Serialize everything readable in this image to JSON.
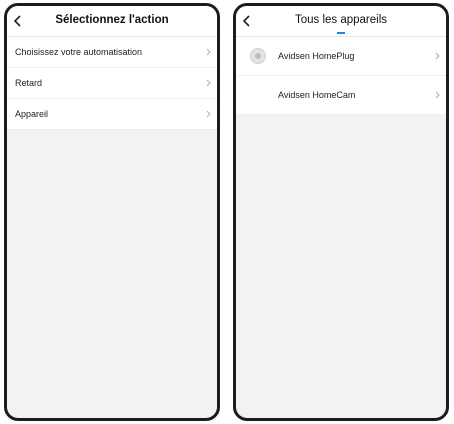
{
  "left_screen": {
    "title": "Sélectionnez l'action",
    "items": [
      {
        "label": "Choisissez votre automatisation"
      },
      {
        "label": "Retard"
      },
      {
        "label": "Appareil"
      }
    ]
  },
  "right_screen": {
    "title": "Tous les appareils",
    "items": [
      {
        "label": "Avidsen HomePlug",
        "icon": "plug-device-icon"
      },
      {
        "label": "Avidsen HomeCam",
        "icon": ""
      }
    ]
  },
  "colors": {
    "frame": "#1c1c1c",
    "background": "#f2f2f2",
    "accent": "#1e88e5"
  },
  "icons": {
    "back": "back-arrow-icon",
    "chevron": "chevron-right-icon"
  }
}
